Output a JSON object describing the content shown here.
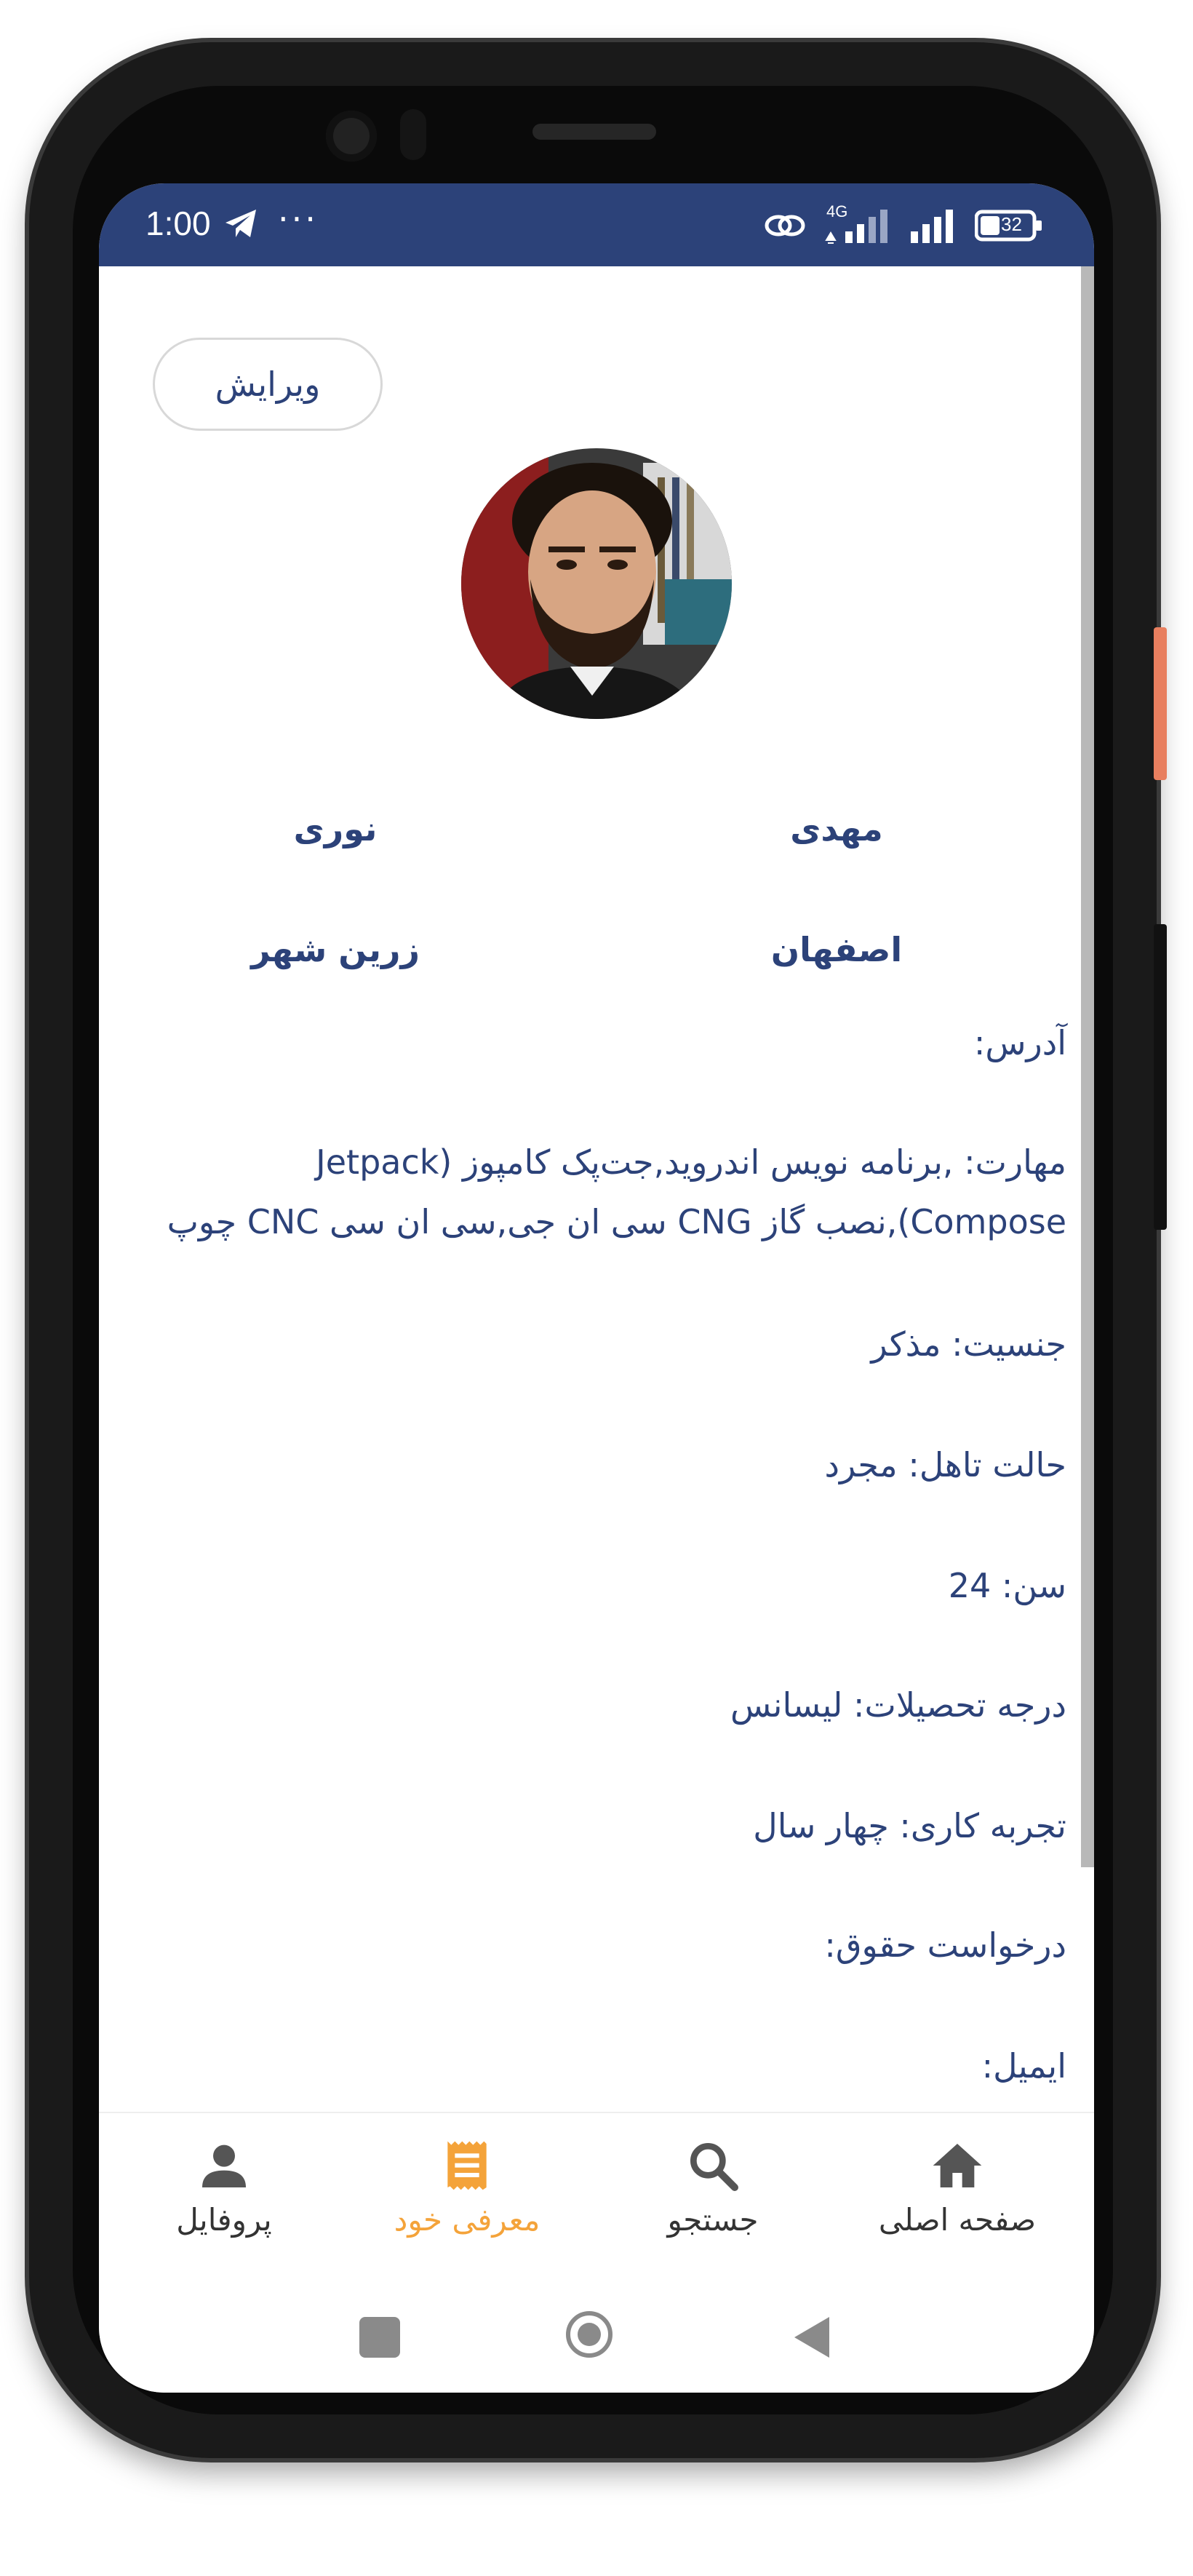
{
  "status_bar": {
    "time": "1:00",
    "more": "···",
    "network_type": "4G",
    "battery": "32"
  },
  "profile": {
    "edit_label": "ویرایش",
    "first_name": "مهدی",
    "last_name": "نوری",
    "province": "اصفهان",
    "city": "زرین شهر"
  },
  "fields": {
    "address": "آدرس:",
    "skills_line1": "مهارت: ,برنامه نویس اندروید,جت‌پک کامپوز (Jetpack",
    "skills_line2": "Compose),نصب گاز CNG سی ان جی,سی ان سی CNC چوپ",
    "gender": "جنسیت: مذکر",
    "marital": "حالت تاهل: مجرد",
    "age": "سن: 24",
    "education": "درجه تحصیلات: لیسانس",
    "experience": "تجربه کاری: چهار سال",
    "salary": "درخواست حقوق:",
    "email": "ایمیل:"
  },
  "bottom_nav": {
    "profile": "پروفایل",
    "introduce": "معرفی خود",
    "search": "جستجو",
    "home": "صفحه اصلی"
  },
  "colors": {
    "primary": "#2c4279",
    "accent": "#f4a33a",
    "nav_icon": "#555555"
  }
}
